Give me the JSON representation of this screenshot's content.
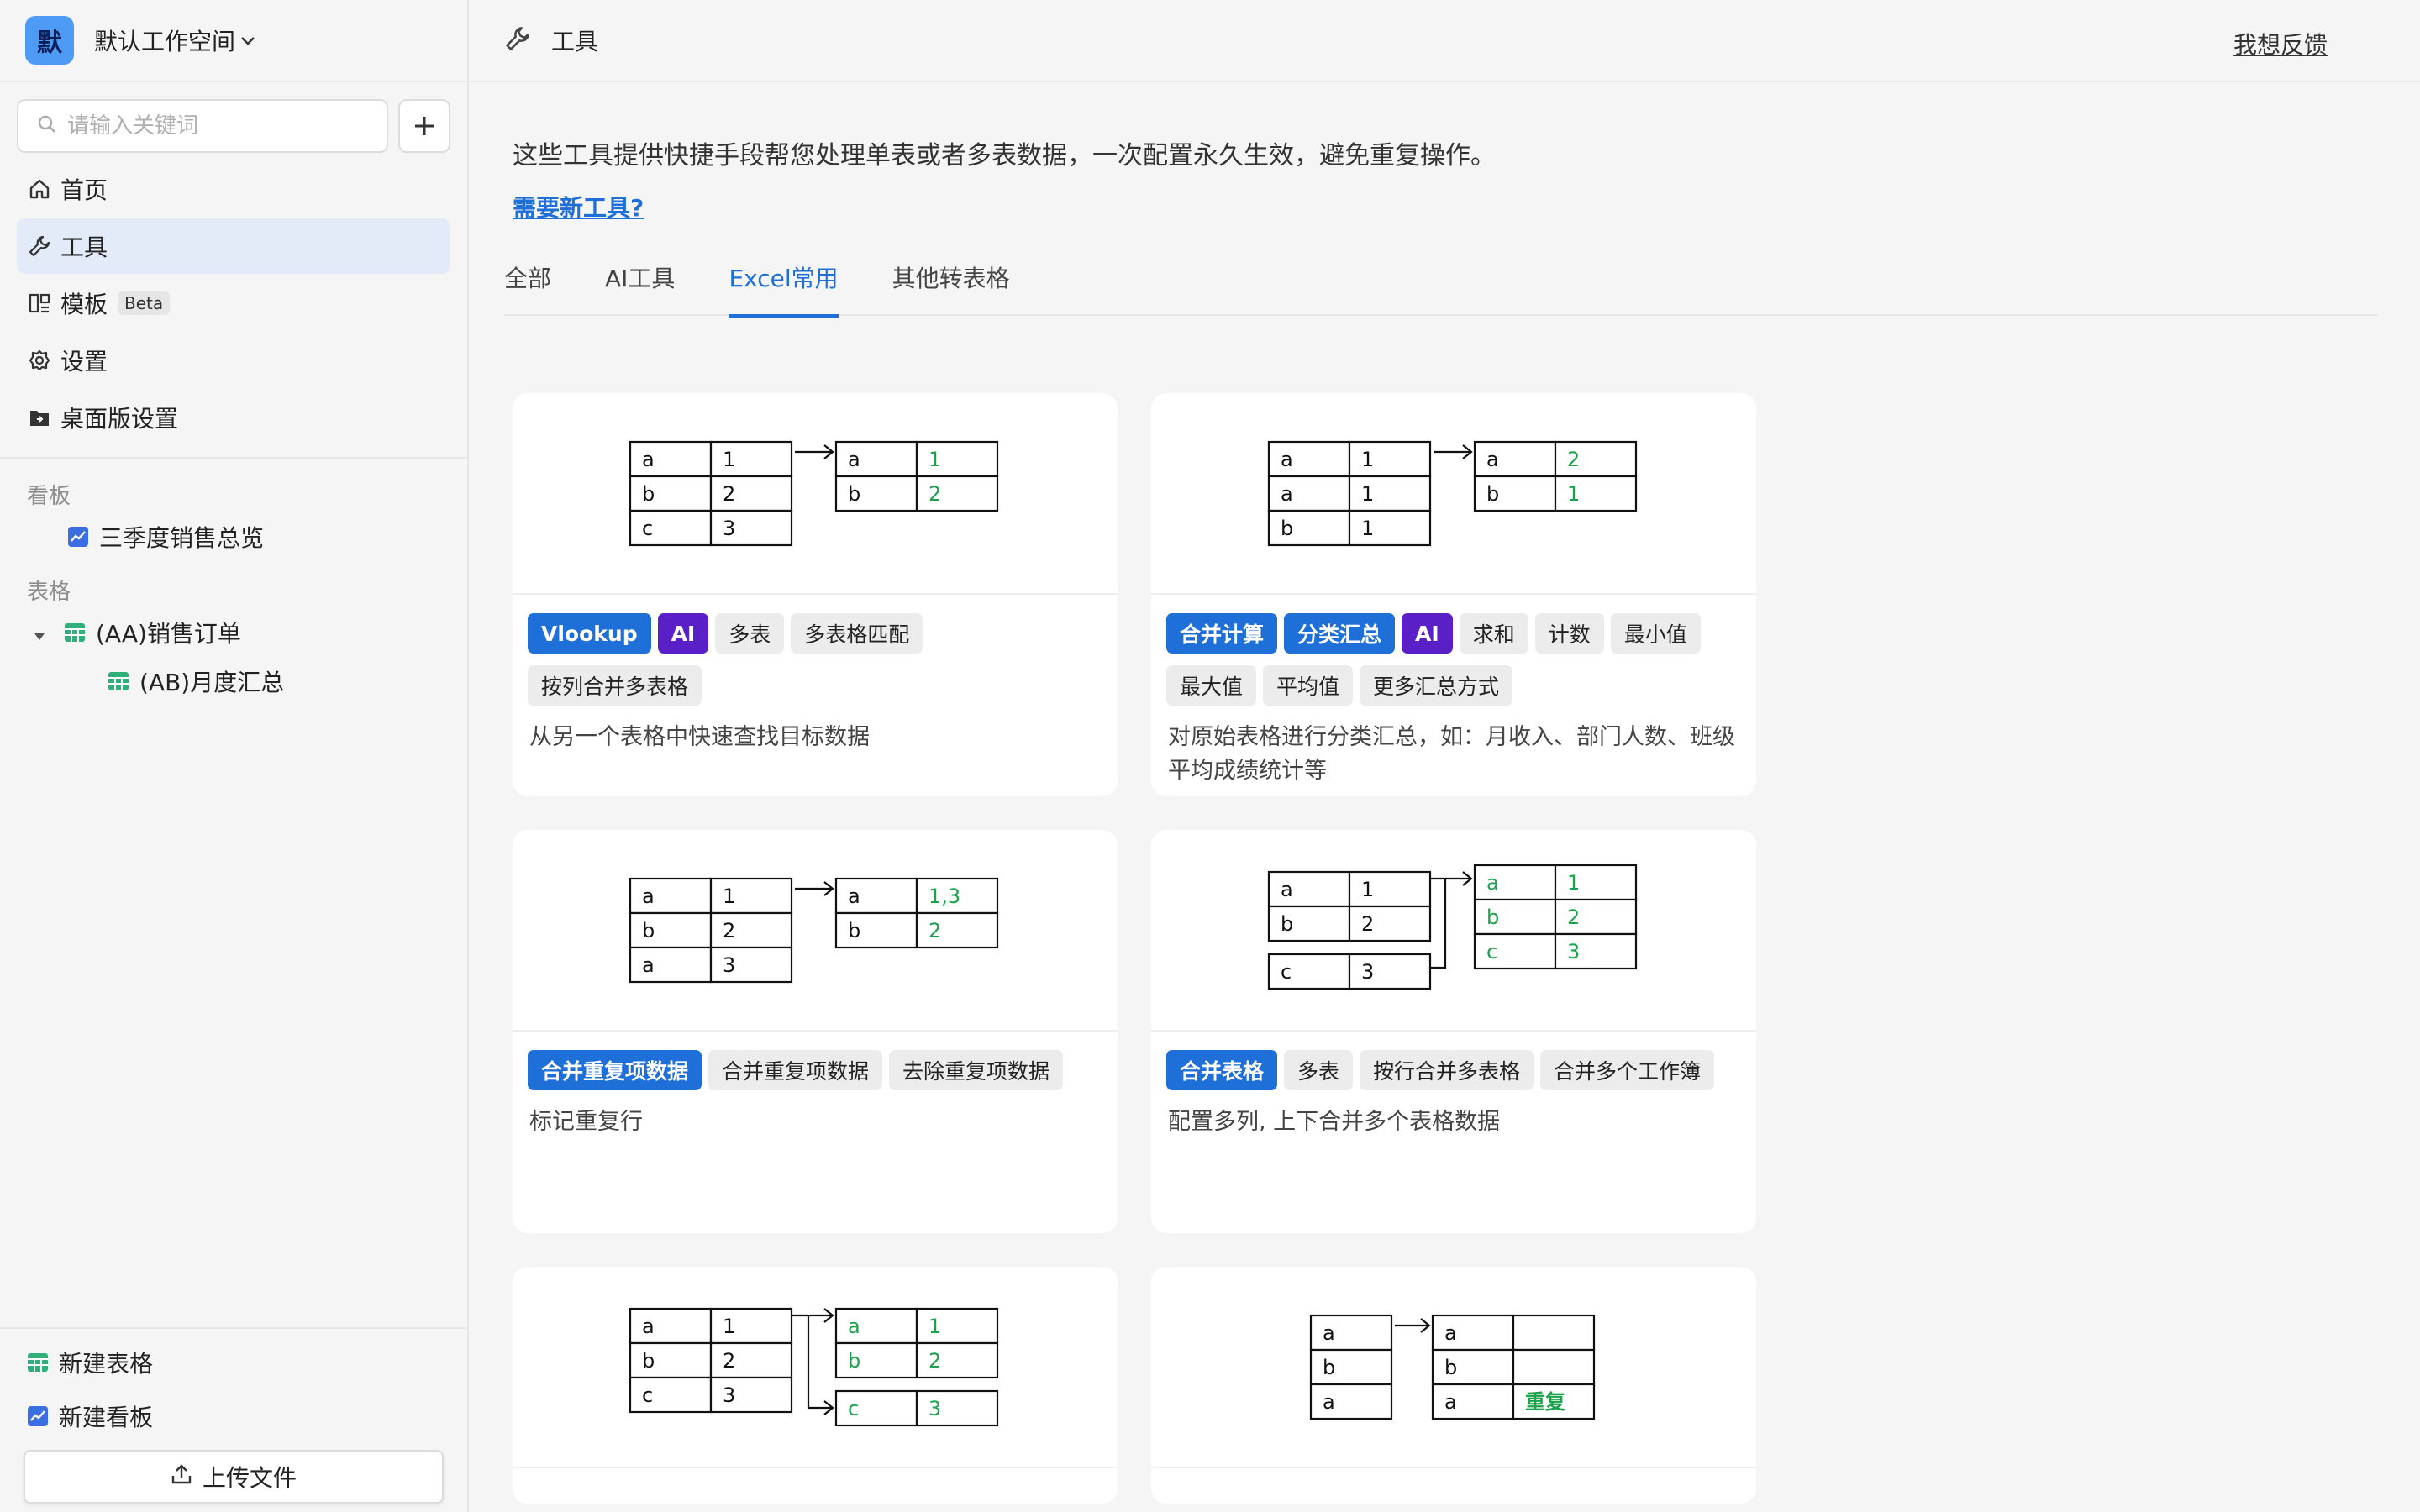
{
  "workspace": {
    "avatar": "默",
    "name": "默认工作空间"
  },
  "search": {
    "placeholder": "请输入关键词"
  },
  "nav": [
    {
      "label": "首页"
    },
    {
      "label": "工具"
    },
    {
      "label": "模板",
      "badge": "Beta"
    },
    {
      "label": "设置"
    },
    {
      "label": "桌面版设置"
    }
  ],
  "sections": {
    "dashboards": "看板",
    "tables": "表格"
  },
  "dashboards": [
    "三季度销售总览"
  ],
  "tables": [
    {
      "label": "(AA)销售订单",
      "children": [
        "(AB)月度汇总"
      ]
    }
  ],
  "bottom": {
    "new_table": "新建表格",
    "new_dashboard": "新建看板",
    "upload": "上传文件"
  },
  "header": {
    "title": "工具",
    "feedback": "我想反馈"
  },
  "intro": "这些工具提供快捷手段帮您处理单表或者多表数据，一次配置永久生效，避免重复操作。",
  "need_tool": "需要新工具?",
  "tabs": [
    "全部",
    "AI工具",
    "Excel常用",
    "其他转表格"
  ],
  "active_tab": "Excel常用",
  "cards": [
    {
      "tags": [
        {
          "label": "Vlookup",
          "style": "blue"
        },
        {
          "label": "AI",
          "style": "ai"
        },
        {
          "label": "多表",
          "style": "gray"
        },
        {
          "label": "多表格匹配",
          "style": "gray"
        },
        {
          "label": "按列合并多表格",
          "style": "gray"
        }
      ],
      "desc": "从另一个表格中快速查找目标数据",
      "illus": {
        "left": [
          [
            "a",
            "1"
          ],
          [
            "b",
            "2"
          ],
          [
            "c",
            "3"
          ]
        ],
        "right": [
          [
            "a",
            "1"
          ],
          [
            "b",
            "2"
          ]
        ]
      }
    },
    {
      "tags": [
        {
          "label": "合并计算",
          "style": "blue"
        },
        {
          "label": "分类汇总",
          "style": "blue"
        },
        {
          "label": "AI",
          "style": "ai"
        },
        {
          "label": "求和",
          "style": "gray"
        },
        {
          "label": "计数",
          "style": "gray"
        },
        {
          "label": "最小值",
          "style": "gray"
        },
        {
          "label": "最大值",
          "style": "gray"
        },
        {
          "label": "平均值",
          "style": "gray"
        },
        {
          "label": "更多汇总方式",
          "style": "gray"
        }
      ],
      "desc": "对原始表格进行分类汇总，如：月收入、部门人数、班级平均成绩统计等",
      "illus": {
        "left": [
          [
            "a",
            "1"
          ],
          [
            "a",
            "1"
          ],
          [
            "b",
            "1"
          ]
        ],
        "right": [
          [
            "a",
            "2"
          ],
          [
            "b",
            "1"
          ]
        ]
      }
    },
    {
      "tags": [
        {
          "label": "合并重复项数据",
          "style": "blue"
        },
        {
          "label": "合并重复项数据",
          "style": "gray"
        },
        {
          "label": "去除重复项数据",
          "style": "gray"
        }
      ],
      "desc": "标记重复行",
      "illus": {
        "left": [
          [
            "a",
            "1"
          ],
          [
            "b",
            "2"
          ],
          [
            "a",
            "3"
          ]
        ],
        "right": [
          [
            "a",
            "1,3"
          ],
          [
            "b",
            "2"
          ]
        ]
      }
    },
    {
      "tags": [
        {
          "label": "合并表格",
          "style": "blue"
        },
        {
          "label": "多表",
          "style": "gray"
        },
        {
          "label": "按行合并多表格",
          "style": "gray"
        },
        {
          "label": "合并多个工作簿",
          "style": "gray"
        }
      ],
      "desc": "配置多列, 上下合并多个表格数据",
      "illus": {
        "left": [
          [
            "a",
            "1"
          ],
          [
            "b",
            "2"
          ],
          [
            "c",
            "3"
          ]
        ],
        "right": [
          [
            "a",
            "1"
          ],
          [
            "b",
            "2"
          ],
          [
            "c",
            "3"
          ]
        ]
      }
    },
    {
      "tags": [],
      "desc": "",
      "illus": {
        "left": [
          [
            "a",
            "1"
          ],
          [
            "b",
            "2"
          ],
          [
            "c",
            "3"
          ]
        ],
        "right": [
          [
            "a",
            "1"
          ],
          [
            "b",
            "2"
          ],
          [
            "c",
            "3"
          ]
        ]
      }
    },
    {
      "tags": [],
      "desc": "",
      "illus": {
        "left": [
          [
            "a"
          ],
          [
            "b"
          ],
          [
            "a"
          ]
        ],
        "right": [
          [
            "a",
            ""
          ],
          [
            "b",
            ""
          ],
          [
            "a",
            "重复"
          ]
        ]
      }
    }
  ],
  "colors": {
    "accent": "#1f6fd8",
    "ai": "#5b1fc7",
    "green": "#1aa34a",
    "active_nav": "#e3ebf8"
  }
}
